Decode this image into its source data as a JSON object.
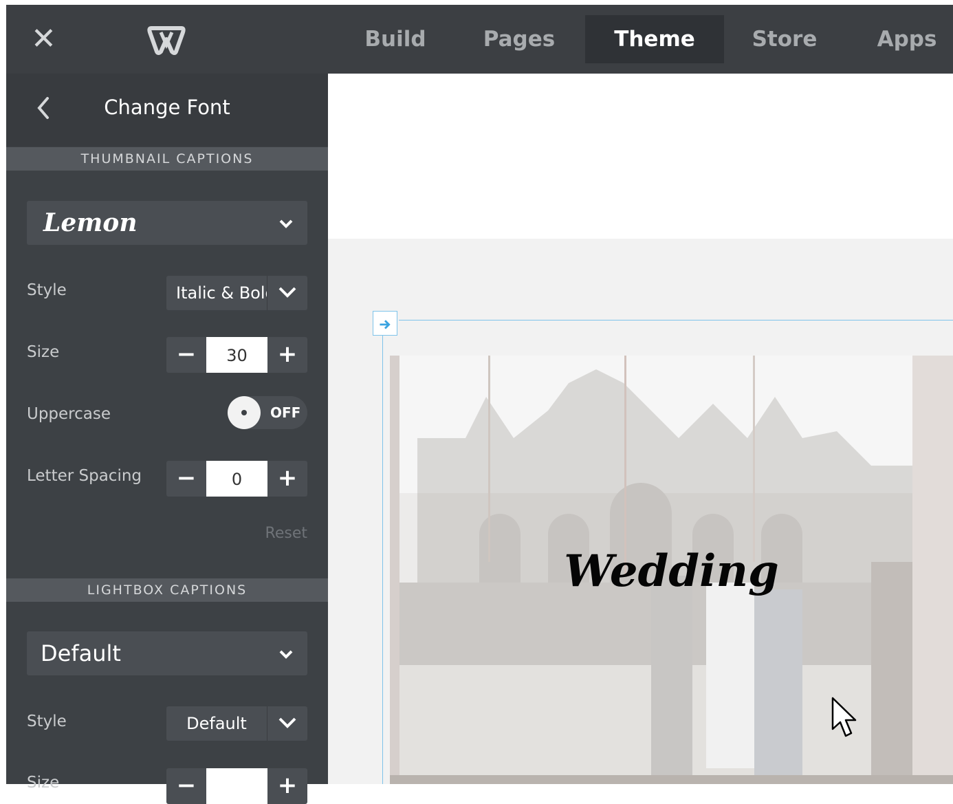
{
  "topbar": {
    "close_icon": "close-icon",
    "logo_icon": "weebly-logo-icon",
    "tabs": [
      {
        "label": "Build",
        "active": false
      },
      {
        "label": "Pages",
        "active": false
      },
      {
        "label": "Theme",
        "active": true
      },
      {
        "label": "Store",
        "active": false
      },
      {
        "label": "Apps",
        "active": false
      }
    ]
  },
  "sidebar": {
    "title": "Change Font",
    "thumbnail": {
      "section_label": "THUMBNAIL CAPTIONS",
      "font": "Lemon",
      "style_label": "Style",
      "style_value": "Italic & Bold",
      "size_label": "Size",
      "size_value": "30",
      "uppercase_label": "Uppercase",
      "uppercase_state": "OFF",
      "letter_spacing_label": "Letter Spacing",
      "letter_spacing_value": "0",
      "reset_label": "Reset"
    },
    "lightbox": {
      "section_label": "LIGHTBOX CAPTIONS",
      "font": "Default",
      "style_label": "Style",
      "style_value": "Default",
      "size_label": "Size",
      "size_value": "+"
    }
  },
  "canvas": {
    "caption": "Wedding"
  },
  "colors": {
    "topbar": "#3c3f43",
    "sidebar": "#3d4145",
    "guide": "#7ec3ea"
  }
}
